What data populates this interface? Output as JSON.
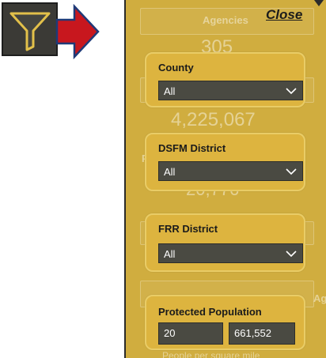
{
  "icons": {
    "filter_toggle": "filter-icon",
    "arrow": "right-arrow-icon",
    "chevron": "chevron-down-icon"
  },
  "colors": {
    "panel_bg": "#d0ad3f",
    "card_bg": "#ddb43f",
    "dropdown_bg": "#4a4a42",
    "arrow_red": "#c8171e",
    "arrow_border": "#1f3a78"
  },
  "panel": {
    "close_label": "Close",
    "background": {
      "agencies_label": "Agencies",
      "agencies_value": "305",
      "population_value": "4,225,067",
      "third_value": "20,776",
      "partial_letter_p": "P",
      "partial_letters_ag": "Ag",
      "footer_text": "People per square mile"
    }
  },
  "slicers": {
    "county": {
      "label": "County",
      "value": "All"
    },
    "dsfm_district": {
      "label": "DSFM District",
      "value": "All"
    },
    "frr_district": {
      "label": "FRR District",
      "value": "All"
    },
    "protected_population": {
      "label": "Protected Population",
      "min": "20",
      "max": "661,552"
    }
  }
}
